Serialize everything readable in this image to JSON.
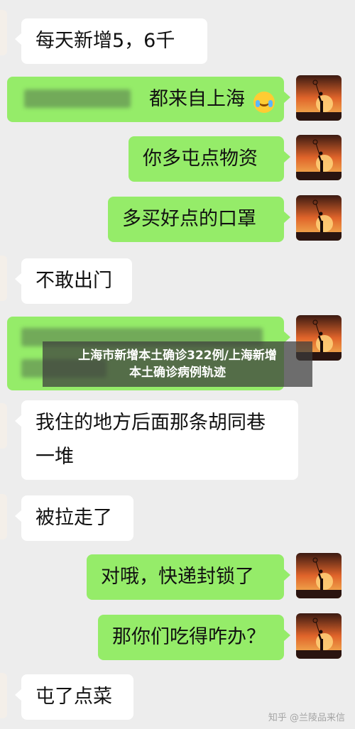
{
  "messages": [
    {
      "side": "left",
      "text": "每天新增5，6千"
    },
    {
      "side": "right",
      "text_visible": "都来自上海",
      "emoji": "crying-laughing-emoji"
    },
    {
      "side": "right",
      "text": "你多屯点物资"
    },
    {
      "side": "right",
      "text": "多买好点的口罩"
    },
    {
      "side": "left",
      "text": "不敢出门"
    },
    {
      "side": "right",
      "text": ""
    },
    {
      "side": "left",
      "line1": "我住的地方后面那条胡同巷",
      "line2": "一堆"
    },
    {
      "side": "left",
      "text": "被拉走了"
    },
    {
      "side": "right",
      "text": "对哦，快递封锁了"
    },
    {
      "side": "right",
      "text": "那你们吃得咋办？"
    },
    {
      "side": "left",
      "text": "屯了点菜"
    }
  ],
  "overlay": {
    "line1": "上海市新增本土确诊322例/上海新增",
    "line2": "本土确诊病例轨迹"
  },
  "watermark": "知乎 @兰陵品来信",
  "colors": {
    "background": "#ededed",
    "sent_bubble": "#95ec69",
    "received_bubble": "#ffffff"
  },
  "icons": {
    "self_avatar": "sunset-silhouette-avatar",
    "contact_avatar": "contact-avatar"
  }
}
